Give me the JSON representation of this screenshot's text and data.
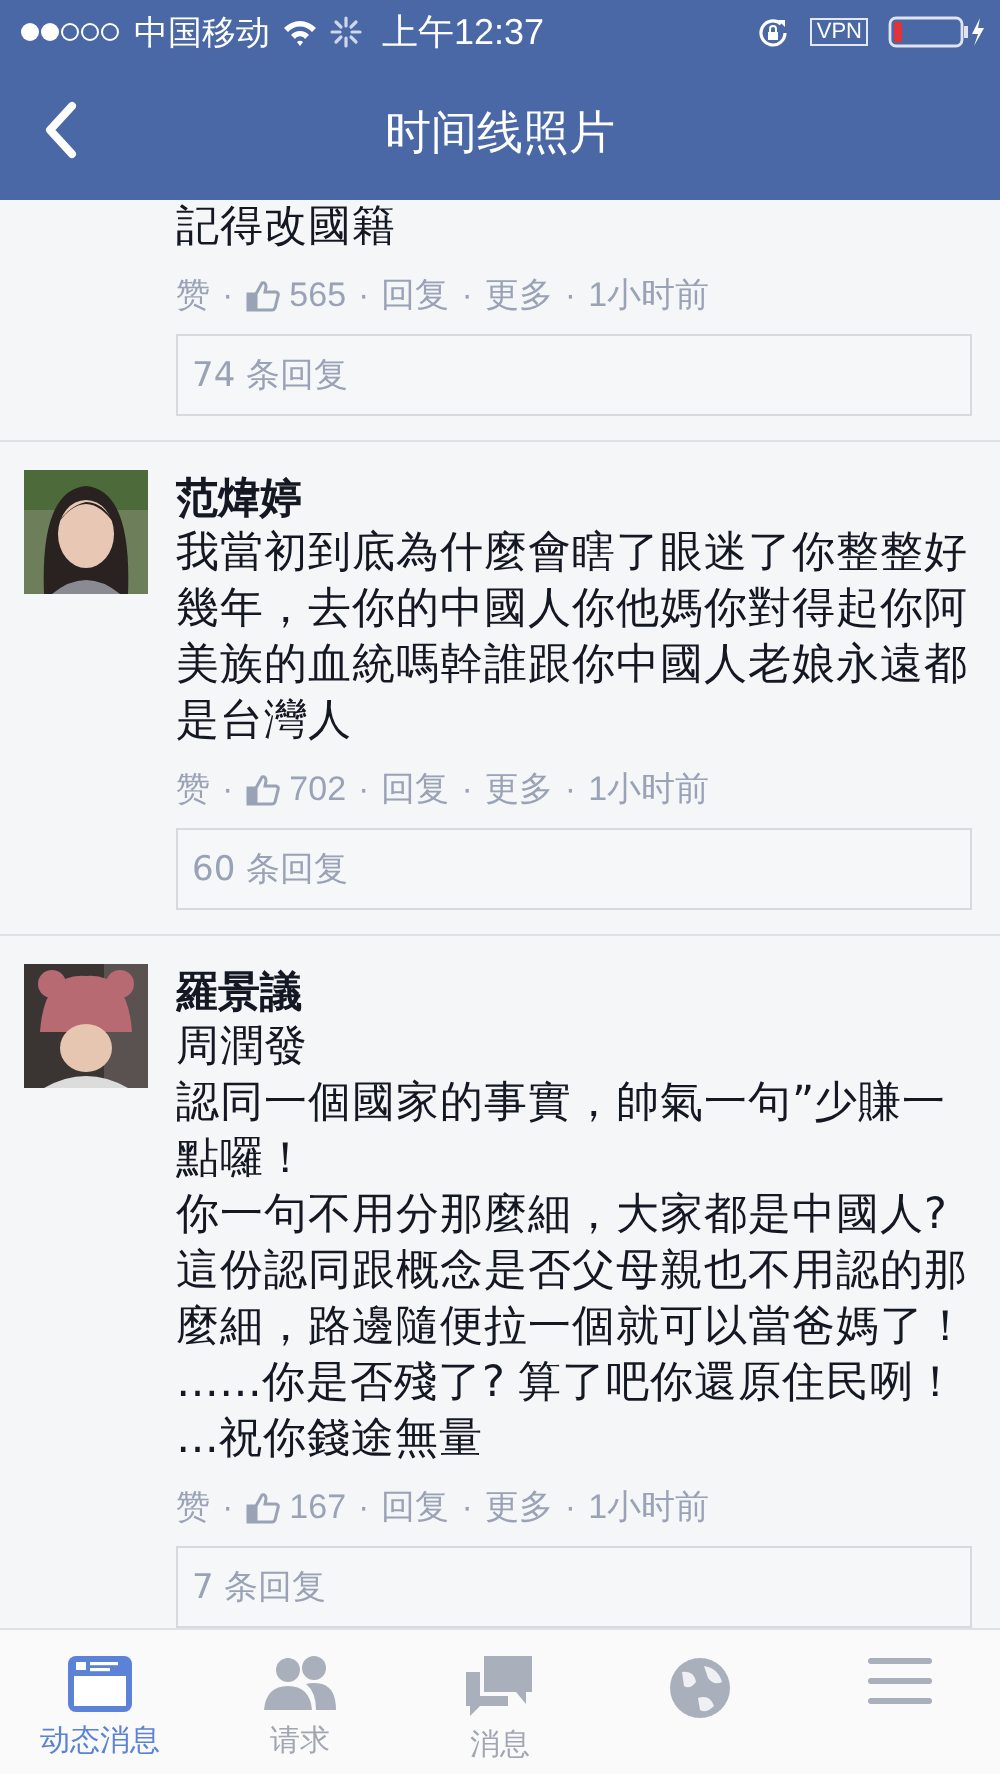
{
  "status_bar": {
    "carrier": "中国移动",
    "time": "上午12:37",
    "vpn": "VPN"
  },
  "nav": {
    "title": "时间线照片"
  },
  "comments": [
    {
      "paragraphs": [
        "記得改國籍"
      ],
      "meta": [
        {
          "kind": "link",
          "text": "赞"
        },
        {
          "kind": "sep",
          "text": "·"
        },
        {
          "kind": "likes",
          "text": "565"
        },
        {
          "kind": "sep",
          "text": "·"
        },
        {
          "kind": "link",
          "text": "回复"
        },
        {
          "kind": "sep",
          "text": "·"
        },
        {
          "kind": "link",
          "text": "更多"
        },
        {
          "kind": "sep",
          "text": "·"
        },
        {
          "kind": "time",
          "text": "1小时前"
        }
      ],
      "replies": "74 条回复"
    },
    {
      "name": "范煒婷",
      "paragraphs": [
        "我當初到底為什麼會瞎了眼迷了你整整好幾年，去你的中國人你他媽你對得起你阿美族的血統嗎幹誰跟你中國人老娘永遠都是台灣人"
      ],
      "meta": [
        {
          "kind": "link",
          "text": "赞"
        },
        {
          "kind": "sep",
          "text": "·"
        },
        {
          "kind": "likes",
          "text": "702"
        },
        {
          "kind": "sep",
          "text": "·"
        },
        {
          "kind": "link",
          "text": "回复"
        },
        {
          "kind": "sep",
          "text": "·"
        },
        {
          "kind": "link",
          "text": "更多"
        },
        {
          "kind": "sep",
          "text": "·"
        },
        {
          "kind": "time",
          "text": "1小时前"
        }
      ],
      "replies": "60 条回复"
    },
    {
      "name": "羅景議",
      "tag": "周潤發",
      "paragraphs": [
        "認同一個國家的事實，帥氣一句”少賺一點囉！",
        "你一句不用分那麼細，大家都是中國人?",
        "這份認同跟概念是否父母親也不用認的那麼細，路邊隨便拉一個就可以當爸媽了！",
        "……你是否殘了? 算了吧你還原住民咧！",
        "…祝你錢途無量"
      ],
      "meta": [
        {
          "kind": "link",
          "text": "赞"
        },
        {
          "kind": "sep",
          "text": "·"
        },
        {
          "kind": "likes",
          "text": "167"
        },
        {
          "kind": "sep",
          "text": "·"
        },
        {
          "kind": "link",
          "text": "回复"
        },
        {
          "kind": "sep",
          "text": "·"
        },
        {
          "kind": "link",
          "text": "更多"
        },
        {
          "kind": "sep",
          "text": "·"
        },
        {
          "kind": "time",
          "text": "1小时前"
        }
      ],
      "replies": "7 条回复"
    }
  ],
  "tabs": [
    {
      "kind": "feed",
      "label": "动态消息",
      "selected": true
    },
    {
      "kind": "friends",
      "label": "请求",
      "selected": false
    },
    {
      "kind": "messages",
      "label": "消息",
      "selected": false
    },
    {
      "kind": "globe",
      "selected": false
    },
    {
      "kind": "menu",
      "selected": false
    }
  ]
}
